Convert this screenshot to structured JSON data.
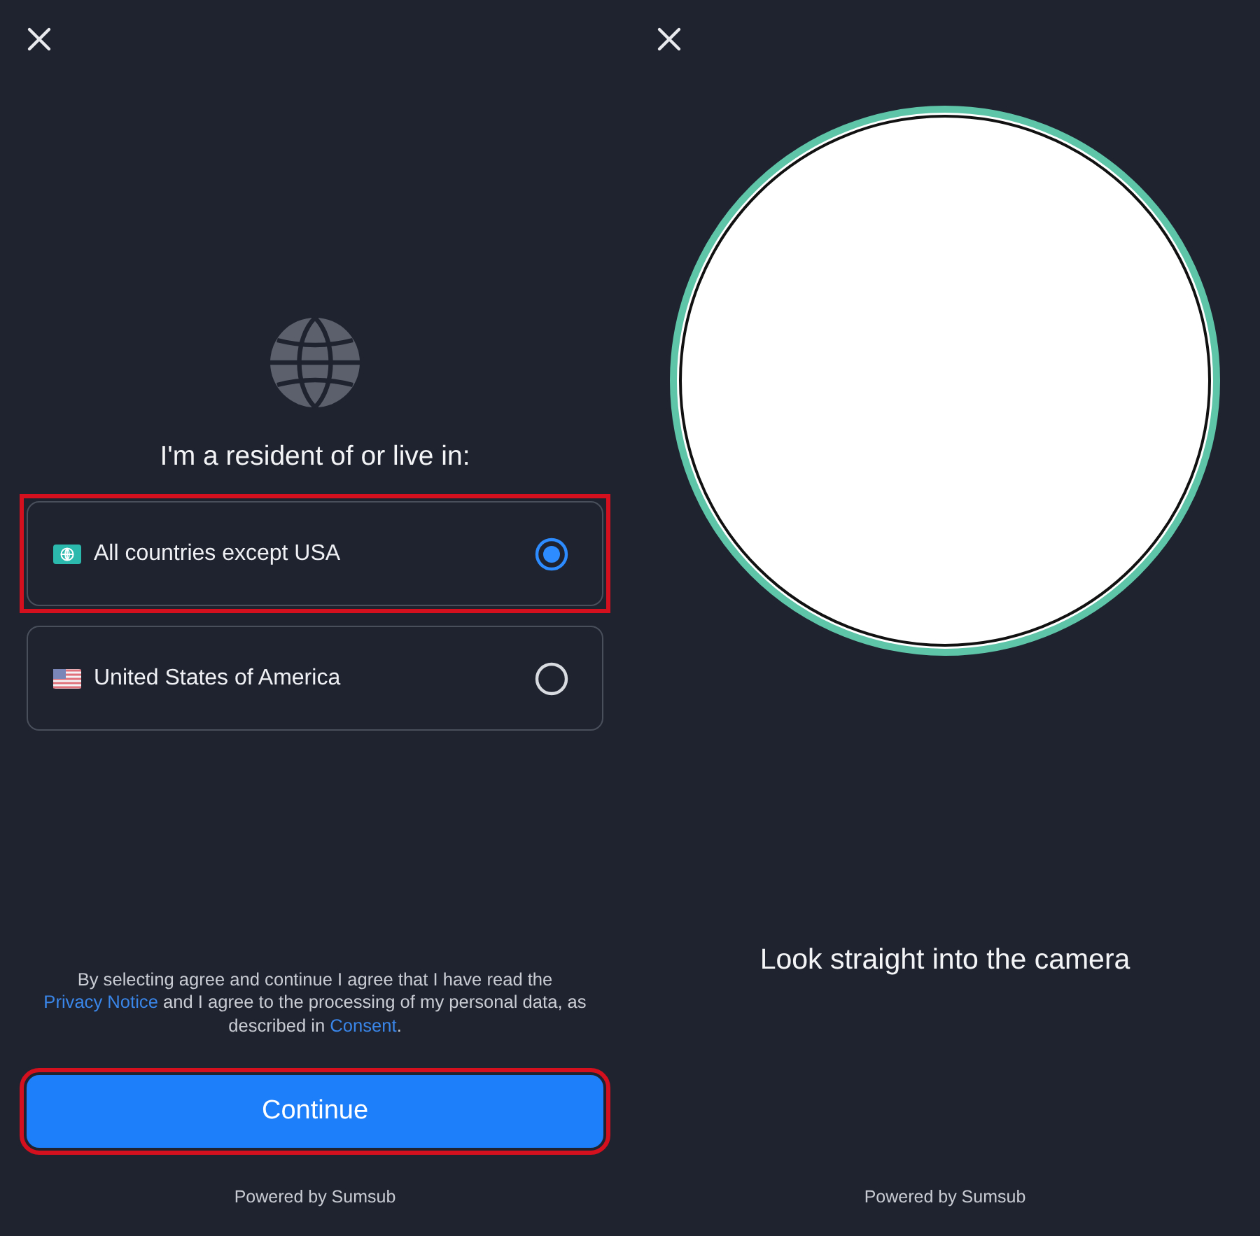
{
  "residence_screen": {
    "heading": "I'm a resident of or live in:",
    "options": [
      {
        "label": "All countries except USA",
        "kind": "globe",
        "selected": true,
        "highlighted": true
      },
      {
        "label": "United States of America",
        "kind": "us-flag",
        "selected": false,
        "highlighted": false
      }
    ],
    "consent": [
      {
        "text": "By selecting agree and continue I agree that I have read the "
      },
      {
        "text": "Privacy Notice",
        "kind": "link"
      },
      {
        "text": " and I agree to the processing of my personal data, as described in "
      },
      {
        "text": "Consent",
        "kind": "link"
      },
      {
        "text": "."
      }
    ],
    "continue_button": {
      "label": "Continue",
      "highlighted": true
    },
    "footer": "Powered by Sumsub"
  },
  "camera_screen": {
    "instruction": "Look straight into the camera",
    "footer": "Powered by Sumsub"
  }
}
